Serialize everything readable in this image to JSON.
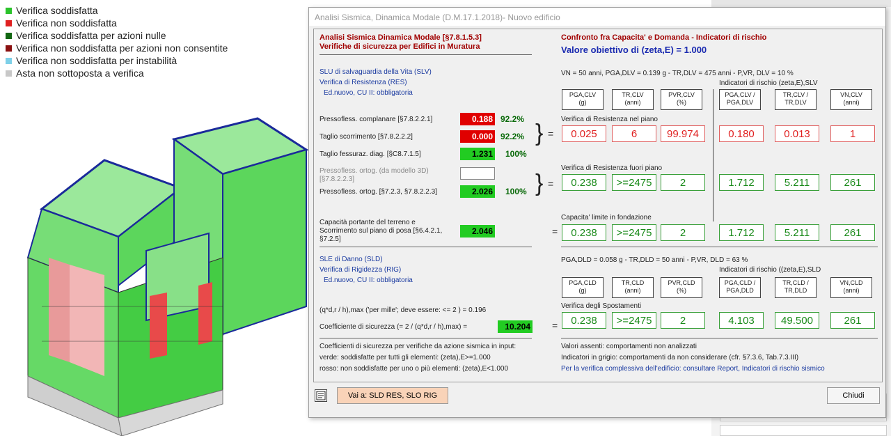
{
  "legend": [
    {
      "label": "Verifica soddisfatta",
      "color": "#2bc32b"
    },
    {
      "label": "Verifica non soddisfatta",
      "color": "#e02020"
    },
    {
      "label": "Verifica soddisfatta per azioni nulle",
      "color": "#116611"
    },
    {
      "label": "Verifica non soddisfatta per azioni non consentite",
      "color": "#8a1010"
    },
    {
      "label": "Verifica non soddisfatta per instabilità",
      "color": "#7ed0e8"
    },
    {
      "label": "Asta non sottoposta a verifica",
      "color": "#c8c8c8"
    }
  ],
  "dialog": {
    "title": "Analisi Sismica, Dinamica Modale (D.M.17.1.2018)- Nuovo edificio",
    "left": {
      "h1": "Analisi Sismica Dinamica Modale [§7.8.1.5.3]",
      "h2": "Verifiche di sicurezza per Edifici in Muratura",
      "slv1": "SLU di salvaguardia della Vita (SLV)",
      "slv2": "Verifica di Resistenza (RES)",
      "slv3": "Ed.nuovo, CU II: obbligatoria",
      "rows": [
        {
          "label": "Pressofless. complanare [§7.8.2.2.1]",
          "value": "0.188",
          "pct": "92.2%"
        },
        {
          "label": "Taglio scorrimento [§7.8.2.2.2]",
          "value": "0.000",
          "pct": "92.2%"
        },
        {
          "label": "Taglio fessuraz. diag. [§C8.7.1.5]",
          "value": "1.231",
          "pct": "100%"
        },
        {
          "label": "Pressofless. ortog. (da modello 3D)",
          "label2": "[§7.8.2.2.3]",
          "value": ""
        },
        {
          "label": "Pressofless. ortog. [§7.2.3, §7.8.2.2.3]",
          "value": "2.026",
          "pct": "100%"
        }
      ],
      "found1": "Capacità portante del terreno e",
      "found2": "Scorrimento sul piano di posa [§6.4.2.1,",
      "found3": "§7.2.5]",
      "found_value": "2.046",
      "sld1": "SLE di Danno (SLD)",
      "sld2": "Verifica di Rigidezza (RIG)",
      "sld3": "Ed.nuovo, CU II: obbligatoria",
      "drift": "(q*d,r / h),max ('per mille'; deve essere: <= 2 ) = 0.196",
      "coef_label": "Coefficiente di sicurezza (= 2 / (q*d,r / h),max) =",
      "coef_value": "10.204",
      "note1": "Coefficienti di sicurezza per verifiche da azione sismica in input:",
      "note2": "verde: soddisfatte per tutti gli elementi: (zeta),E>=1.000",
      "note3": "rosso: non soddisfatte per uno o più elementi: (zeta),E<1.000"
    },
    "right": {
      "h1": "Confronto fra Capacita' e Domanda - Indicatori di rischio",
      "h2": "Valore obiettivo di (zeta,E) = 1.000",
      "slv_params": "VN = 50 anni, PGA,DLV = 0.139 g - TR,DLV = 475 anni - P,VR, DLV = 10 %",
      "slv_ind": "Indicatori di rischio (zeta,E),SLV",
      "slv_headers": [
        {
          "l1": "PGA,CLV",
          "l2": "(g)"
        },
        {
          "l1": "TR,CLV",
          "l2": "(anni)"
        },
        {
          "l1": "PVR,CLV",
          "l2": "(%)"
        },
        {
          "l1": "PGA,CLV /",
          "l2": "PGA,DLV"
        },
        {
          "l1": "TR,CLV /",
          "l2": "TR,DLV"
        },
        {
          "l1": "VN,CLV",
          "l2": "(anni)"
        }
      ],
      "sec1": "Verifica di Resistenza nel piano",
      "row1": [
        "0.025",
        "6",
        "99.974",
        "0.180",
        "0.013",
        "1"
      ],
      "sec2": "Verifica di Resistenza fuori piano",
      "row2": [
        "0.238",
        ">=2475",
        "2",
        "1.712",
        "5.211",
        "261"
      ],
      "sec3": "Capacita' limite in fondazione",
      "row3": [
        "0.238",
        ">=2475",
        "2",
        "1.712",
        "5.211",
        "261"
      ],
      "sld_params": "PGA,DLD = 0.058 g - TR,DLD = 50 anni - P,VR, DLD = 63 %",
      "sld_ind": "Indicatori di rischio ((zeta,E),SLD",
      "sld_headers": [
        {
          "l1": "PGA,CLD",
          "l2": "(g)"
        },
        {
          "l1": "TR,CLD",
          "l2": "(anni)"
        },
        {
          "l1": "PVR,CLD",
          "l2": "(%)"
        },
        {
          "l1": "PGA,CLD /",
          "l2": "PGA,DLD"
        },
        {
          "l1": "TR,CLD /",
          "l2": "TR,DLD"
        },
        {
          "l1": "VN,CLD",
          "l2": "(anni)"
        }
      ],
      "sec4": "Verifica degli Spostamenti",
      "row4": [
        "0.238",
        ">=2475",
        "2",
        "4.103",
        "49.500",
        "261"
      ],
      "note1": "Valori assenti: comportamenti non analizzati",
      "note2": "Indicatori in grigio: comportamenti da non considerare (cfr. §7.3.6, Tab.7.3.III)",
      "note3": "Per la verifica complessiva dell'edificio: consultare Report, Indicatori di rischio sismico"
    },
    "goto_button": "Vai a: SLD RES, SLO RIG",
    "close_button": "Chiudi"
  }
}
